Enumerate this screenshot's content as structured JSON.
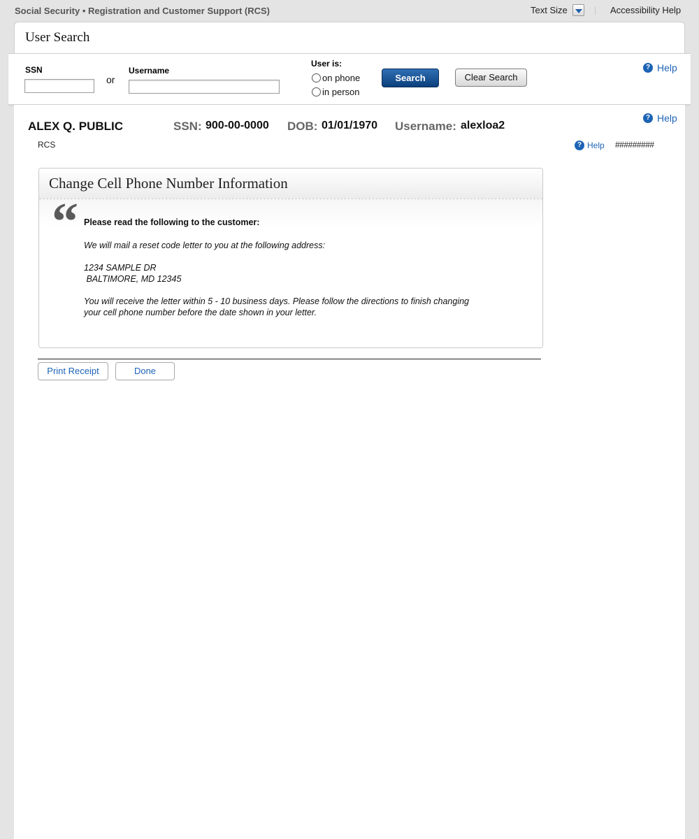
{
  "header": {
    "site_title": "Social Security • Registration and Customer Support (RCS)",
    "text_size_label": "Text Size",
    "accessibility_help": "Accessibility Help"
  },
  "search": {
    "title": "User Search",
    "ssn_label": "SSN",
    "ssn_value": "",
    "or_text": "or",
    "username_label": "Username",
    "username_value": "",
    "user_is_label": "User is:",
    "option_phone": "on phone",
    "option_person": "in person",
    "search_button": "Search",
    "clear_button": "Clear Search",
    "help": "Help"
  },
  "customer": {
    "name": "ALEX Q. PUBLIC",
    "ssn_label": "SSN:",
    "ssn": "900-00-0000",
    "dob_label": "DOB:",
    "dob": "01/01/1970",
    "username_label": "Username:",
    "username": "alexloa2",
    "help_top": "Help",
    "app_label": "RCS",
    "help_small": "Help",
    "code": "#########"
  },
  "panel": {
    "title": "Change Cell Phone Number Information",
    "instruction": "Please read the following to the customer:",
    "line1": "We will mail a reset code letter to you at the following address:",
    "address_line1": "1234 SAMPLE DR",
    "address_line2": " BALTIMORE, MD 12345",
    "line2a": "You will receive the letter within 5 - 10 business days. Please follow the directions to finish changing",
    "line2b": "your cell phone number before the date shown in your letter."
  },
  "actions": {
    "print_receipt": "Print Receipt",
    "done": "Done"
  },
  "colors": {
    "link_blue": "#1e64b6",
    "primary_button": "#0b3f7c",
    "page_background": "#e4e4e4"
  }
}
